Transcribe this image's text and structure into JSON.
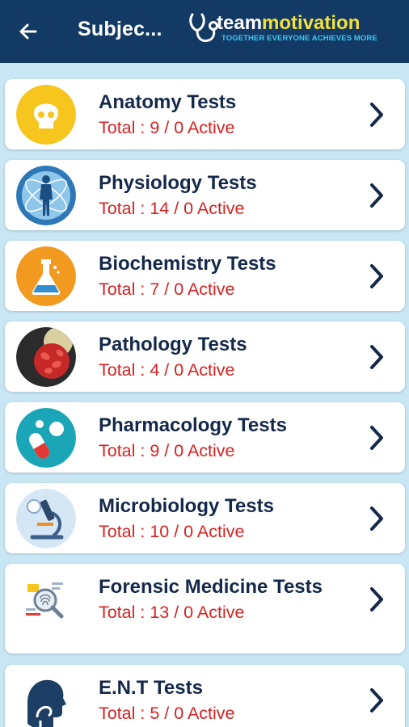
{
  "header": {
    "back_icon": "arrow-left-icon",
    "title": "Subjec...",
    "brand": {
      "name_part1": "team",
      "name_part2": "motivation",
      "tagline": "TOGETHER EVERYONE ACHIEVES MORE"
    }
  },
  "colors": {
    "header_bg": "#123a64",
    "page_bg": "#c9e6f4",
    "title_text": "#14294a",
    "count_text": "#d62222"
  },
  "subjects": [
    {
      "title": "Anatomy Tests",
      "subtitle": "Total : 9 / 0 Active",
      "icon": "skull-icon"
    },
    {
      "title": "Physiology Tests",
      "subtitle": "Total : 14 / 0 Active",
      "icon": "human-body-icon"
    },
    {
      "title": "Biochemistry Tests",
      "subtitle": "Total : 7 / 0 Active",
      "icon": "flask-icon"
    },
    {
      "title": "Pathology Tests",
      "subtitle": "Total : 4 / 0 Active",
      "icon": "blood-cells-icon"
    },
    {
      "title": "Pharmacology Tests",
      "subtitle": "Total : 9 / 0 Active",
      "icon": "pills-icon"
    },
    {
      "title": "Microbiology Tests",
      "subtitle": "Total : 10 / 0 Active",
      "icon": "microscope-icon"
    },
    {
      "title": "Forensic Medicine Tests",
      "subtitle": "Total : 13 / 0 Active",
      "icon": "magnifier-fingerprint-icon"
    },
    {
      "title": "E.N.T Tests",
      "subtitle": "Total : 5 / 0 Active",
      "icon": "head-profile-icon"
    }
  ]
}
